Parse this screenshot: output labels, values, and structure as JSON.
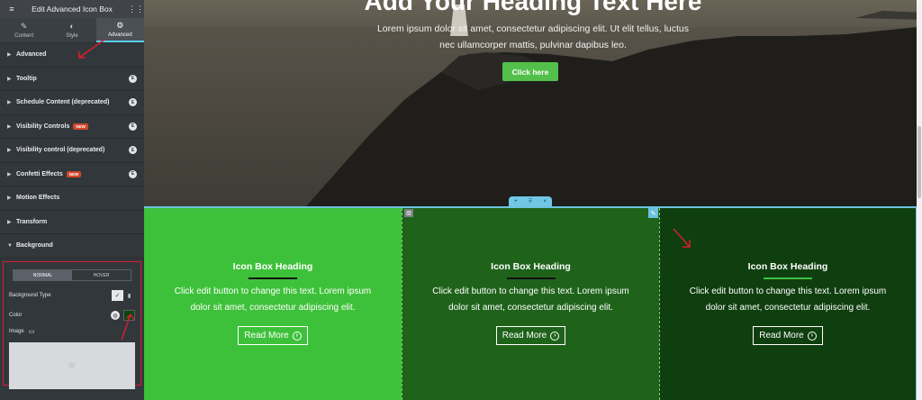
{
  "panel": {
    "title": "Edit Advanced Icon Box",
    "tabs": [
      {
        "label": "Content",
        "icon": "pencil-icon"
      },
      {
        "label": "Style",
        "icon": "half-circle-icon"
      },
      {
        "label": "Advanced",
        "icon": "gear-icon"
      }
    ],
    "sections": [
      {
        "label": "Advanced"
      },
      {
        "label": "Tooltip"
      },
      {
        "label": "Schedule Content (deprecated)"
      },
      {
        "label": "Visibility Controls",
        "badge": "NEW"
      },
      {
        "label": "Visibility control (deprecated)"
      },
      {
        "label": "Confetti Effects",
        "badge": "NEW"
      },
      {
        "label": "Motion Effects"
      },
      {
        "label": "Transform"
      },
      {
        "label": "Background"
      }
    ],
    "background": {
      "tab_normal": "NORMAL",
      "tab_hover": "HOVER",
      "bg_type_label": "Background Type",
      "color_label": "Color",
      "image_label": "Image",
      "color_value": "#0c4512"
    }
  },
  "hero": {
    "heading": "Add Your Heading Text Here",
    "subtext": "Lorem ipsum dolor sit amet, consectetur adipiscing elit. Ut elit tellus, luctus nec ullamcorper mattis, pulvinar dapibus leo.",
    "button": "Click here"
  },
  "boxes": [
    {
      "heading": "Icon Box Heading",
      "text": "Click edit button to change this text. Lorem ipsum dolor sit amet, consectetur adipiscing elit.",
      "button": "Read More",
      "bg": "#3ec13a"
    },
    {
      "heading": "Icon Box Heading",
      "text": "Click edit button to change this text. Lorem ipsum dolor sit amet, consectetur adipiscing elit.",
      "button": "Read More",
      "bg": "#1f631b"
    },
    {
      "heading": "Icon Box Heading",
      "text": "Click edit button to change this text. Lorem ipsum dolor sit amet, consectetur adipiscing elit.",
      "button": "Read More",
      "bg": "#0f3f0f"
    }
  ],
  "colors": {
    "accent": "#6cc3e0",
    "alert": "#d61f2c",
    "button_green": "#52c04a"
  }
}
